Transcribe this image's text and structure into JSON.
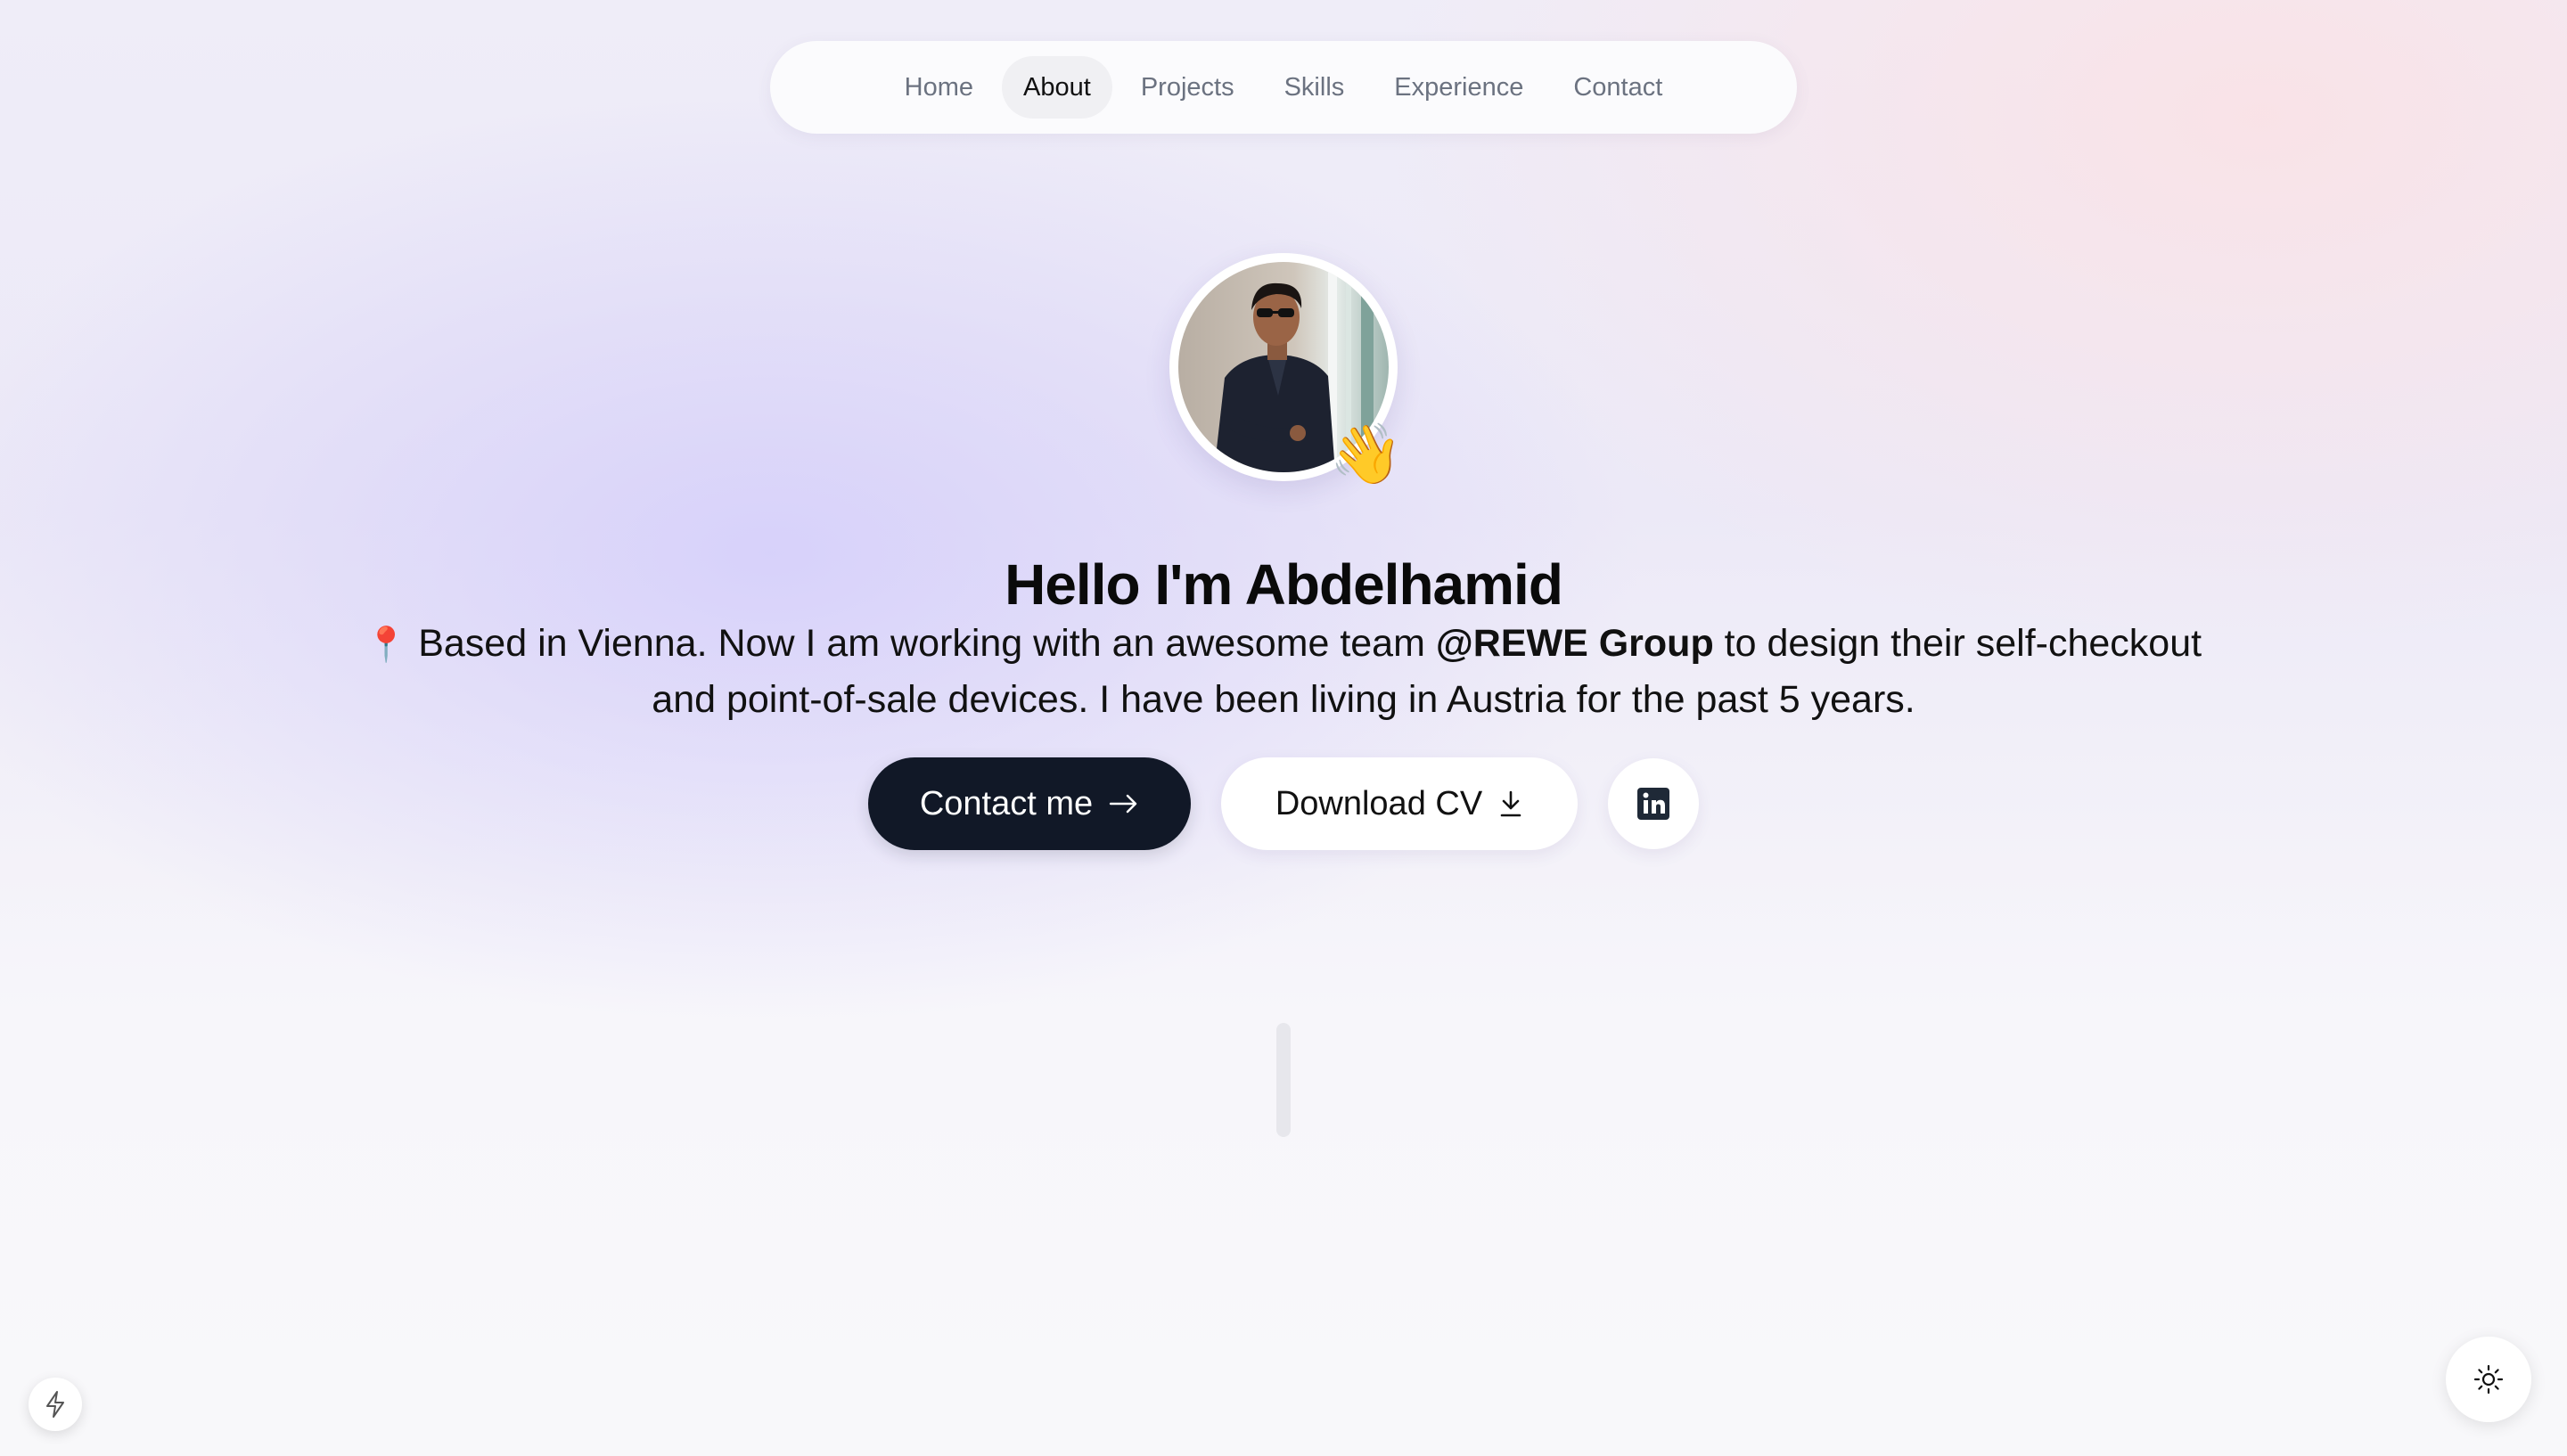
{
  "nav": {
    "items": [
      {
        "label": "Home",
        "active": false
      },
      {
        "label": "About",
        "active": true
      },
      {
        "label": "Projects",
        "active": false
      },
      {
        "label": "Skills",
        "active": false
      },
      {
        "label": "Experience",
        "active": false
      },
      {
        "label": "Contact",
        "active": false
      }
    ]
  },
  "hero": {
    "avatar_icon": "profile-photo",
    "wave_emoji": "👋",
    "headline": "Hello I'm Abdelhamid",
    "bio": {
      "pin_emoji": "📍",
      "before": " Based in Vienna. Now I am working with an awesome team ",
      "company": "@REWE Group",
      "after": " to design their self-checkout and point-of-sale devices. I have been living in Austria for the past 5 years."
    },
    "buttons": {
      "contact_label": "Contact me",
      "contact_icon": "arrow-right-icon",
      "cv_label": "Download CV",
      "cv_icon": "download-icon",
      "linkedin_icon": "linkedin-icon"
    }
  },
  "floating": {
    "left_icon": "lightning-icon",
    "right_icon": "sun-icon"
  },
  "colors": {
    "primary_button": "#111827",
    "active_nav_bg": "#f0f0f3",
    "nav_text": "#6b7280"
  }
}
